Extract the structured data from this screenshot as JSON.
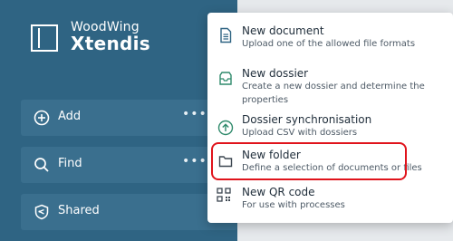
{
  "brand": {
    "name_top": "WoodWing",
    "name_bottom": "Xtendis"
  },
  "sidebar": {
    "items": [
      {
        "label": "Add",
        "icon": "plus-circle-icon",
        "more": "•••"
      },
      {
        "label": "Find",
        "icon": "search-icon",
        "more": "•••"
      },
      {
        "label": "Shared",
        "icon": "shared-shield-icon"
      }
    ]
  },
  "menu": {
    "items": [
      {
        "title": "New document",
        "description": "Upload one of the allowed file formats",
        "icon": "document-icon"
      },
      {
        "title": "New dossier",
        "description": "Create a new dossier and determine the properties",
        "icon": "dossier-inbox-icon"
      },
      {
        "title": "Dossier synchronisation",
        "description": "Upload CSV with dossiers",
        "icon": "upload-arrow-icon"
      },
      {
        "title": "New folder",
        "description": "Define a selection of documents or files",
        "icon": "folder-icon"
      },
      {
        "title": "New QR code",
        "description": "For use with processes",
        "icon": "qr-code-icon"
      }
    ],
    "highlighted": "New folder"
  },
  "colors": {
    "sidebar_bg": "#2f6483",
    "nav_item_bg": "#3a6f8e",
    "highlight": "#e0141c",
    "accent_icon": "#2f8a6b"
  }
}
